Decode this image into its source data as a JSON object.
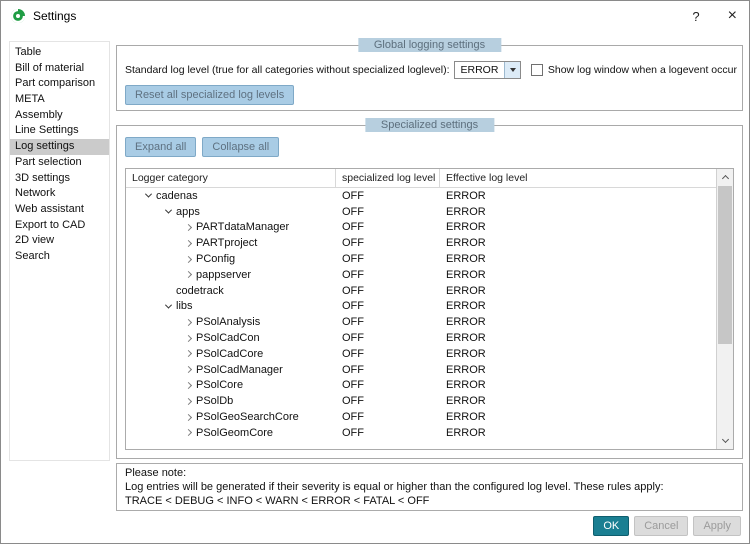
{
  "window": {
    "title": "Settings",
    "help_label": "?",
    "close_label": "×",
    "app_icon": "cadenas-logo"
  },
  "sidebar": {
    "items": [
      {
        "label": "Table",
        "selected": false
      },
      {
        "label": "Bill of material",
        "selected": false
      },
      {
        "label": "Part comparison",
        "selected": false
      },
      {
        "label": "META",
        "selected": false
      },
      {
        "label": "Assembly",
        "selected": false
      },
      {
        "label": "Line Settings",
        "selected": false
      },
      {
        "label": "Log settings",
        "selected": true
      },
      {
        "label": "Part selection",
        "selected": false
      },
      {
        "label": "3D settings",
        "selected": false
      },
      {
        "label": "Network",
        "selected": false
      },
      {
        "label": "Web assistant",
        "selected": false
      },
      {
        "label": "Export to CAD",
        "selected": false
      },
      {
        "label": "2D view",
        "selected": false
      },
      {
        "label": "Search",
        "selected": false
      }
    ]
  },
  "global_group": {
    "title": "Global logging settings",
    "standard_label": "Standard log level (true for all categories without specialized loglevel):",
    "level_value": "ERROR",
    "combo_arrow_icon": "chevron-down",
    "checkbox_label": "Show log window when a logevent occur",
    "checkbox_checked": false,
    "reset_button": "Reset all specialized log levels"
  },
  "specialized_group": {
    "title": "Specialized settings",
    "expand_button": "Expand all",
    "collapse_button": "Collapse all",
    "table": {
      "columns": [
        "Logger category",
        "specialized log level",
        "Effective log level"
      ],
      "rows": [
        {
          "label": "cadenas",
          "level": 1,
          "exp": "open",
          "specialized": "OFF",
          "effective": "ERROR"
        },
        {
          "label": "apps",
          "level": 2,
          "exp": "open",
          "specialized": "OFF",
          "effective": "ERROR"
        },
        {
          "label": "PARTdataManager",
          "level": 3,
          "exp": "closed",
          "specialized": "OFF",
          "effective": "ERROR"
        },
        {
          "label": "PARTproject",
          "level": 3,
          "exp": "closed",
          "specialized": "OFF",
          "effective": "ERROR"
        },
        {
          "label": "PConfig",
          "level": 3,
          "exp": "closed",
          "specialized": "OFF",
          "effective": "ERROR"
        },
        {
          "label": "pappserver",
          "level": 3,
          "exp": "closed",
          "specialized": "OFF",
          "effective": "ERROR"
        },
        {
          "label": "codetrack",
          "level": 2,
          "exp": "none",
          "specialized": "OFF",
          "effective": "ERROR"
        },
        {
          "label": "libs",
          "level": 2,
          "exp": "open",
          "specialized": "OFF",
          "effective": "ERROR"
        },
        {
          "label": "PSolAnalysis",
          "level": 3,
          "exp": "closed",
          "specialized": "OFF",
          "effective": "ERROR"
        },
        {
          "label": "PSolCadCon",
          "level": 3,
          "exp": "closed",
          "specialized": "OFF",
          "effective": "ERROR"
        },
        {
          "label": "PSolCadCore",
          "level": 3,
          "exp": "closed",
          "specialized": "OFF",
          "effective": "ERROR"
        },
        {
          "label": "PSolCadManager",
          "level": 3,
          "exp": "closed",
          "specialized": "OFF",
          "effective": "ERROR"
        },
        {
          "label": "PSolCore",
          "level": 3,
          "exp": "closed",
          "specialized": "OFF",
          "effective": "ERROR"
        },
        {
          "label": "PSolDb",
          "level": 3,
          "exp": "closed",
          "specialized": "OFF",
          "effective": "ERROR"
        },
        {
          "label": "PSolGeoSearchCore",
          "level": 3,
          "exp": "closed",
          "specialized": "OFF",
          "effective": "ERROR"
        },
        {
          "label": "PSolGeomCore",
          "level": 3,
          "exp": "closed",
          "specialized": "OFF",
          "effective": "ERROR"
        }
      ]
    }
  },
  "note": {
    "line1": "Please note:",
    "line2": "Log entries will be generated if their severity is equal or higher than the configured log level. These rules apply:",
    "line3": "TRACE < DEBUG < INFO < WARN < ERROR < FATAL < OFF"
  },
  "footer": {
    "ok_label": "OK",
    "cancel_label": "Cancel",
    "apply_label": "Apply"
  },
  "colors": {
    "blue_button_bg": "#a9cce5",
    "group_label_bg": "#b7cfdf",
    "ok_button_bg": "#1a7f92",
    "selected_sidebar_item": "#cbcbcb",
    "logo_green": "#1f9d44"
  }
}
